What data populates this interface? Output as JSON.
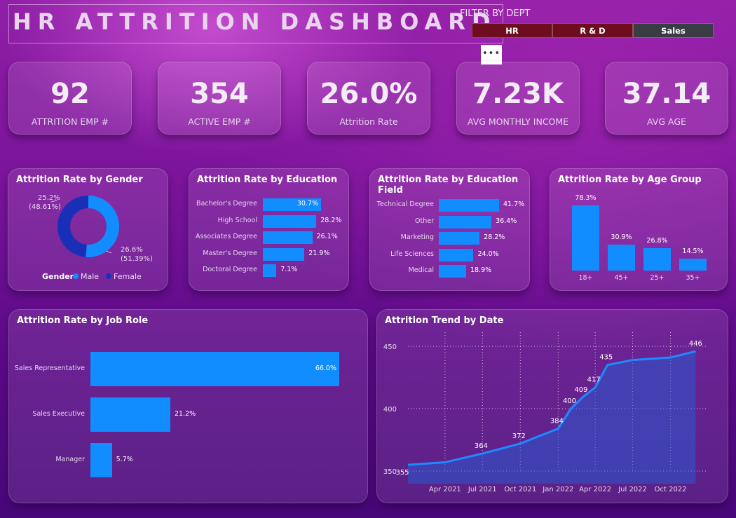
{
  "header": {
    "title": "HR ATTRITION DASHBOARD",
    "filter_label": "FILTER BY DEPT",
    "more_label": "•••"
  },
  "filter": {
    "options": [
      "HR",
      "R & D",
      "Sales"
    ],
    "selected": "Sales"
  },
  "kpis": [
    {
      "value": "92",
      "label": "ATTRITION EMP #"
    },
    {
      "value": "354",
      "label": "ACTIVE EMP #"
    },
    {
      "value": "26.0%",
      "label": "Attrition Rate"
    },
    {
      "value": "7.23K",
      "label": "AVG MONTHLY INCOME"
    },
    {
      "value": "37.14",
      "label": "AVG AGE"
    }
  ],
  "colors": {
    "accent": "#118dff",
    "female": "#1a2fb8",
    "male": "#118dff",
    "slicer_active": "#6e0d1f",
    "slicer_selected": "#3a3c44"
  },
  "chart_data": [
    {
      "type": "pie",
      "title": "Attrition Rate by Gender",
      "legend_title": "Gender",
      "categories": [
        "Male",
        "Female"
      ],
      "values": [
        26.6,
        25.2
      ],
      "percent_of_total": [
        "(51.39%)",
        "(48.61%)"
      ],
      "labels": [
        "26.6%",
        "25.2%"
      ]
    },
    {
      "type": "bar",
      "title": "Attrition Rate by Education",
      "categories": [
        "Bachelor's Degree",
        "High School",
        "Associates Degree",
        "Master's Degree",
        "Doctoral Degree"
      ],
      "values": [
        30.7,
        28.2,
        26.1,
        21.9,
        7.1
      ],
      "labels": [
        "30.7%",
        "28.2%",
        "26.1%",
        "21.9%",
        "7.1%"
      ]
    },
    {
      "type": "bar",
      "title": "Attrition Rate by Education Field",
      "categories": [
        "Technical Degree",
        "Other",
        "Marketing",
        "Life Sciences",
        "Medical"
      ],
      "values": [
        41.7,
        36.4,
        28.2,
        24.0,
        18.9
      ],
      "labels": [
        "41.7%",
        "36.4%",
        "28.2%",
        "24.0%",
        "18.9%"
      ]
    },
    {
      "type": "bar",
      "title": "Attrition Rate by Age Group",
      "categories": [
        "18+",
        "45+",
        "25+",
        "35+"
      ],
      "values": [
        78.3,
        30.9,
        26.8,
        14.5
      ],
      "labels": [
        "78.3%",
        "30.9%",
        "26.8%",
        "14.5%"
      ]
    },
    {
      "type": "bar",
      "title": "Attrition Rate by Job Role",
      "categories": [
        "Sales Representative",
        "Sales Executive",
        "Manager"
      ],
      "values": [
        66.0,
        21.2,
        5.7
      ],
      "labels": [
        "66.0%",
        "21.2%",
        "5.7%"
      ]
    },
    {
      "type": "area",
      "title": "Attrition Trend by Date",
      "ylim": [
        350,
        450
      ],
      "yticks": [
        350,
        400,
        450
      ],
      "xticks": [
        "Apr 2021",
        "Jul 2021",
        "Oct 2021",
        "Jan 2022",
        "Apr 2022",
        "Jul 2022",
        "Oct 2022"
      ],
      "x": [
        "2021-01",
        "2021-04",
        "2021-07",
        "2021-10",
        "2022-01",
        "2022-02",
        "2022-03",
        "2022-04",
        "2022-05",
        "2022-07",
        "2022-10",
        "2022-12"
      ],
      "y": [
        355,
        357,
        364,
        372,
        384,
        400,
        409,
        417,
        435,
        439,
        441,
        446
      ],
      "point_labels": [
        "355",
        "",
        "364",
        "372",
        "384",
        "400",
        "409",
        "417",
        "435",
        "",
        "",
        "446"
      ]
    }
  ]
}
